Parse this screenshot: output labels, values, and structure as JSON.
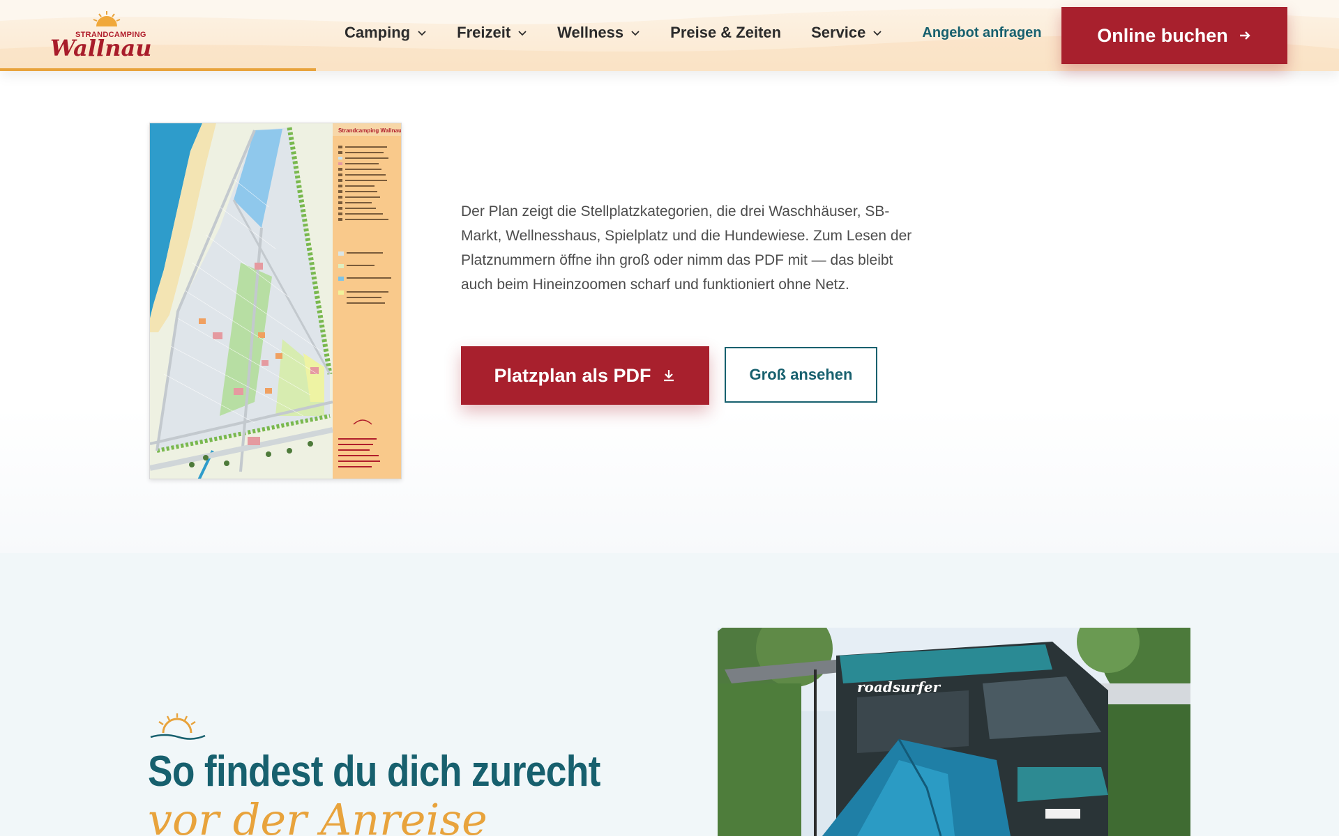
{
  "brand": {
    "name_top": "STRANDCAMPING",
    "name_main": "Wallnau"
  },
  "nav": {
    "items": [
      {
        "label": "Camping",
        "has_dropdown": true
      },
      {
        "label": "Freizeit",
        "has_dropdown": true
      },
      {
        "label": "Wellness",
        "has_dropdown": true
      },
      {
        "label": "Preise & Zeiten",
        "has_dropdown": false
      },
      {
        "label": "Service",
        "has_dropdown": true
      }
    ],
    "offer_link": "Angebot anfragen",
    "book_button": "Online buchen"
  },
  "scroll_progress": 0.236,
  "map_section": {
    "map_title": "Strandcamping Wallnau",
    "description": "Der Plan zeigt die Stellplatzkategorien, die drei Waschhäuser, SB-Markt, Wellnesshaus, Spielplatz und die Hundewiese. Zum Lesen der Platznummern öffne ihn groß oder nimm das PDF mit — das bleibt auch beim Hineinzoomen scharf und funktioniert ohne Netz.",
    "pdf_button": "Platzplan als PDF",
    "view_button": "Groß ansehen"
  },
  "orientation_section": {
    "heading": "So findest du dich zurecht",
    "subheading": "vor der Anreise",
    "van_brand": "roadsurfer"
  },
  "colors": {
    "brand_red": "#a8202d",
    "teal": "#17606e",
    "accent_orange": "#e8a33c",
    "header_bg": "#fbe8cf",
    "section_bg": "#f1f7f9"
  },
  "icons": {
    "dropdown": "chevron-down-icon",
    "book_arrow": "arrow-right-icon",
    "pdf_download": "download-icon",
    "decor": "sun-wave-icon"
  }
}
